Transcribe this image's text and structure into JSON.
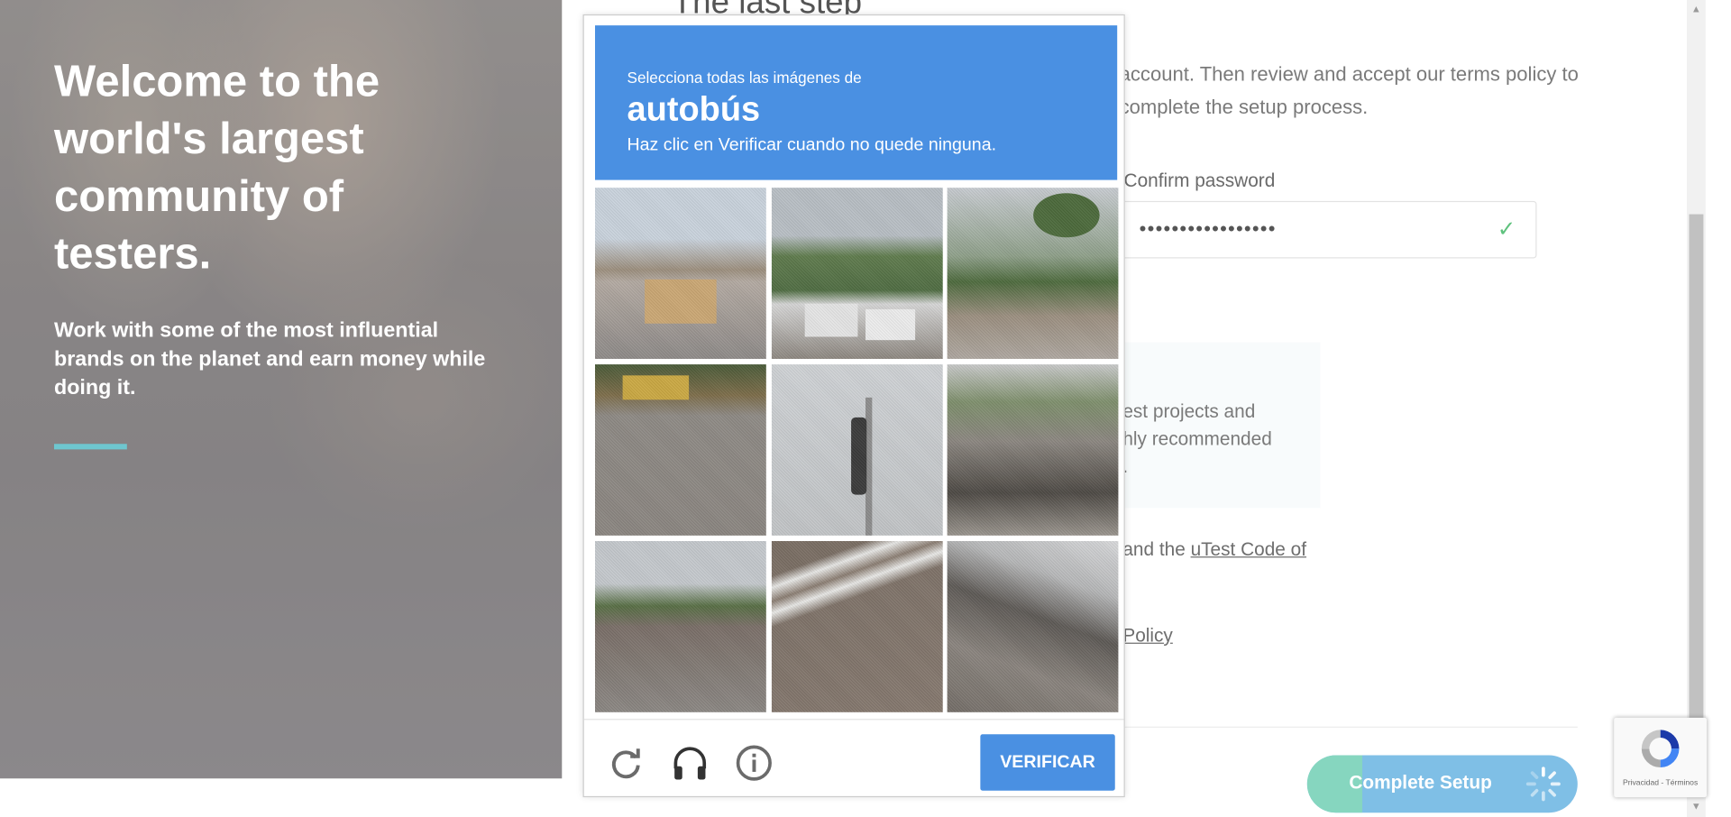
{
  "hero": {
    "heading": "Welcome to the world's largest community of testers.",
    "subheading": "Work with some of the most influential brands on the planet and earn money while doing it.",
    "accent_color": "#6ec6cf"
  },
  "form": {
    "step_title": "The last step",
    "intro_text": "account. Then review and accept our terms policy to complete the setup process.",
    "confirm_password_label": "Confirm password",
    "confirm_password_value": "•••••••••••••••••",
    "info_box_text": "est projects and\nhly recommended\n.",
    "terms_prefix": "and the ",
    "terms_link": "uTest Code of",
    "policy_link": "Policy",
    "complete_button": "Complete Setup"
  },
  "captcha": {
    "prompt_small": "Selecciona todas las imágenes de",
    "target_object": "autobús",
    "instruction": "Haz clic en Verificar cuando no quede ninguna.",
    "verify_button": "VERIFICAR",
    "header_color": "#4a90e2",
    "tile_count": 9,
    "footer_icons": [
      "reload-icon",
      "headphones-icon",
      "info-icon"
    ]
  },
  "recaptcha_badge": {
    "text": "Privacidad - Términos"
  }
}
